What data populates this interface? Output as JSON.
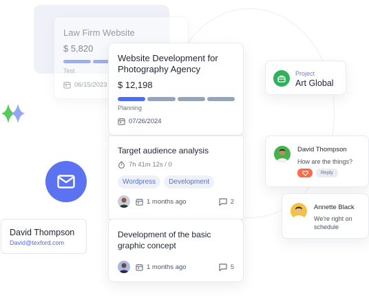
{
  "cards": {
    "law_firm": {
      "title": "Law Firm Website",
      "amount": "$ 5,820",
      "stage": "Test",
      "date": "06/15/2023",
      "progress_segments_total": 4,
      "progress_segments_done": 2
    },
    "web_dev": {
      "title": "Website Development for Photography Agency",
      "amount": "$ 12,198",
      "stage": "Planning",
      "date": "07/26/2024",
      "progress_segments_total": 4,
      "progress_segments_done": 1
    },
    "target": {
      "title": "Target audience analysis",
      "timer": "7h 41m 12s / 0",
      "tags": [
        "Wordpress",
        "Development"
      ],
      "time_ago": "1 months ago",
      "comments": "2"
    },
    "development": {
      "title": "Development of the basic graphic concept",
      "time_ago": "1 months ago",
      "comments": "5"
    }
  },
  "contact": {
    "name": "David Thompson",
    "email": "David@texford.com"
  },
  "project": {
    "label": "Project",
    "value": "Art Global"
  },
  "chats": [
    {
      "name": "David Thompson",
      "message": "How are the things?",
      "reply_label": "Reply"
    },
    {
      "name": "Annette Black",
      "message": "We're right on schedule"
    }
  ],
  "colors": {
    "accent": "#4c6ef5",
    "mail_circle": "#5b73f0",
    "project_icon": "#2fb15c",
    "heart": "#f46e4d"
  },
  "icons": [
    "calendar-icon",
    "timer-icon",
    "comment-icon",
    "mail-icon",
    "briefcase-icon",
    "heart-icon",
    "sparkle-icon"
  ]
}
